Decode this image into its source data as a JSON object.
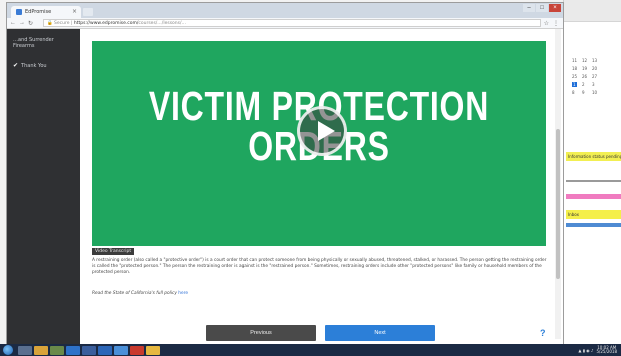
{
  "browser": {
    "tab_title": "EdPromise",
    "address_scheme": "Secure",
    "address_url": "https://www.edpromise.com/",
    "address_rest": "courses/…/lessons/…"
  },
  "sidebar": {
    "prev_item": "…and Surrender\nFirearms",
    "thank_you": "Thank You"
  },
  "video": {
    "title_line1": "VICTIM PROTECTION",
    "title_line2": "ORDERS"
  },
  "lesson": {
    "label": "Video Transcript",
    "description": "A restraining order (also called a \"protective order\") is a court order that can protect someone from being physically or sexually abused, threatened, stalked, or harassed. The person getting the restraining order is called the \"protected person.\" The person the restraining order is against is the \"restrained person.\" Sometimes, restraining orders include other \"protected persons\" like family or household members of the protected person.",
    "read_more_prefix": "Read the State of California's full policy ",
    "read_more_link": "here"
  },
  "nav": {
    "previous_label": "Previous",
    "next_label": "Next",
    "help_label": "?"
  },
  "background_app": {
    "yellow_item": "Information status pending re...",
    "yellow_item2": "Inbox"
  },
  "taskbar": {
    "time": "10:02 AM",
    "date": "5/25/2018"
  },
  "colors": {
    "video_green": "#1fa65f",
    "next_blue": "#2c7fd8",
    "sidebar_dark": "#2f3033",
    "taskbar": "#1b2a44"
  },
  "icons": [
    "back-icon",
    "forward-icon",
    "reload-icon",
    "lock-icon",
    "star-icon",
    "menu-icon",
    "play-icon",
    "check-icon",
    "windows-start-icon"
  ]
}
